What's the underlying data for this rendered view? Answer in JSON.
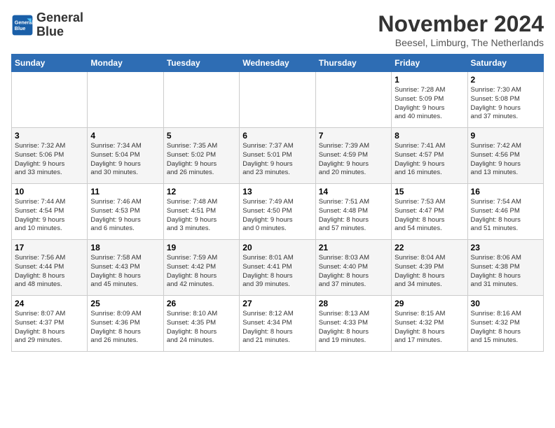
{
  "logo": {
    "line1": "General",
    "line2": "Blue"
  },
  "title": "November 2024",
  "subtitle": "Beesel, Limburg, The Netherlands",
  "days_header": [
    "Sunday",
    "Monday",
    "Tuesday",
    "Wednesday",
    "Thursday",
    "Friday",
    "Saturday"
  ],
  "weeks": [
    [
      {
        "day": "",
        "info": ""
      },
      {
        "day": "",
        "info": ""
      },
      {
        "day": "",
        "info": ""
      },
      {
        "day": "",
        "info": ""
      },
      {
        "day": "",
        "info": ""
      },
      {
        "day": "1",
        "info": "Sunrise: 7:28 AM\nSunset: 5:09 PM\nDaylight: 9 hours\nand 40 minutes."
      },
      {
        "day": "2",
        "info": "Sunrise: 7:30 AM\nSunset: 5:08 PM\nDaylight: 9 hours\nand 37 minutes."
      }
    ],
    [
      {
        "day": "3",
        "info": "Sunrise: 7:32 AM\nSunset: 5:06 PM\nDaylight: 9 hours\nand 33 minutes."
      },
      {
        "day": "4",
        "info": "Sunrise: 7:34 AM\nSunset: 5:04 PM\nDaylight: 9 hours\nand 30 minutes."
      },
      {
        "day": "5",
        "info": "Sunrise: 7:35 AM\nSunset: 5:02 PM\nDaylight: 9 hours\nand 26 minutes."
      },
      {
        "day": "6",
        "info": "Sunrise: 7:37 AM\nSunset: 5:01 PM\nDaylight: 9 hours\nand 23 minutes."
      },
      {
        "day": "7",
        "info": "Sunrise: 7:39 AM\nSunset: 4:59 PM\nDaylight: 9 hours\nand 20 minutes."
      },
      {
        "day": "8",
        "info": "Sunrise: 7:41 AM\nSunset: 4:57 PM\nDaylight: 9 hours\nand 16 minutes."
      },
      {
        "day": "9",
        "info": "Sunrise: 7:42 AM\nSunset: 4:56 PM\nDaylight: 9 hours\nand 13 minutes."
      }
    ],
    [
      {
        "day": "10",
        "info": "Sunrise: 7:44 AM\nSunset: 4:54 PM\nDaylight: 9 hours\nand 10 minutes."
      },
      {
        "day": "11",
        "info": "Sunrise: 7:46 AM\nSunset: 4:53 PM\nDaylight: 9 hours\nand 6 minutes."
      },
      {
        "day": "12",
        "info": "Sunrise: 7:48 AM\nSunset: 4:51 PM\nDaylight: 9 hours\nand 3 minutes."
      },
      {
        "day": "13",
        "info": "Sunrise: 7:49 AM\nSunset: 4:50 PM\nDaylight: 9 hours\nand 0 minutes."
      },
      {
        "day": "14",
        "info": "Sunrise: 7:51 AM\nSunset: 4:48 PM\nDaylight: 8 hours\nand 57 minutes."
      },
      {
        "day": "15",
        "info": "Sunrise: 7:53 AM\nSunset: 4:47 PM\nDaylight: 8 hours\nand 54 minutes."
      },
      {
        "day": "16",
        "info": "Sunrise: 7:54 AM\nSunset: 4:46 PM\nDaylight: 8 hours\nand 51 minutes."
      }
    ],
    [
      {
        "day": "17",
        "info": "Sunrise: 7:56 AM\nSunset: 4:44 PM\nDaylight: 8 hours\nand 48 minutes."
      },
      {
        "day": "18",
        "info": "Sunrise: 7:58 AM\nSunset: 4:43 PM\nDaylight: 8 hours\nand 45 minutes."
      },
      {
        "day": "19",
        "info": "Sunrise: 7:59 AM\nSunset: 4:42 PM\nDaylight: 8 hours\nand 42 minutes."
      },
      {
        "day": "20",
        "info": "Sunrise: 8:01 AM\nSunset: 4:41 PM\nDaylight: 8 hours\nand 39 minutes."
      },
      {
        "day": "21",
        "info": "Sunrise: 8:03 AM\nSunset: 4:40 PM\nDaylight: 8 hours\nand 37 minutes."
      },
      {
        "day": "22",
        "info": "Sunrise: 8:04 AM\nSunset: 4:39 PM\nDaylight: 8 hours\nand 34 minutes."
      },
      {
        "day": "23",
        "info": "Sunrise: 8:06 AM\nSunset: 4:38 PM\nDaylight: 8 hours\nand 31 minutes."
      }
    ],
    [
      {
        "day": "24",
        "info": "Sunrise: 8:07 AM\nSunset: 4:37 PM\nDaylight: 8 hours\nand 29 minutes."
      },
      {
        "day": "25",
        "info": "Sunrise: 8:09 AM\nSunset: 4:36 PM\nDaylight: 8 hours\nand 26 minutes."
      },
      {
        "day": "26",
        "info": "Sunrise: 8:10 AM\nSunset: 4:35 PM\nDaylight: 8 hours\nand 24 minutes."
      },
      {
        "day": "27",
        "info": "Sunrise: 8:12 AM\nSunset: 4:34 PM\nDaylight: 8 hours\nand 21 minutes."
      },
      {
        "day": "28",
        "info": "Sunrise: 8:13 AM\nSunset: 4:33 PM\nDaylight: 8 hours\nand 19 minutes."
      },
      {
        "day": "29",
        "info": "Sunrise: 8:15 AM\nSunset: 4:32 PM\nDaylight: 8 hours\nand 17 minutes."
      },
      {
        "day": "30",
        "info": "Sunrise: 8:16 AM\nSunset: 4:32 PM\nDaylight: 8 hours\nand 15 minutes."
      }
    ]
  ]
}
